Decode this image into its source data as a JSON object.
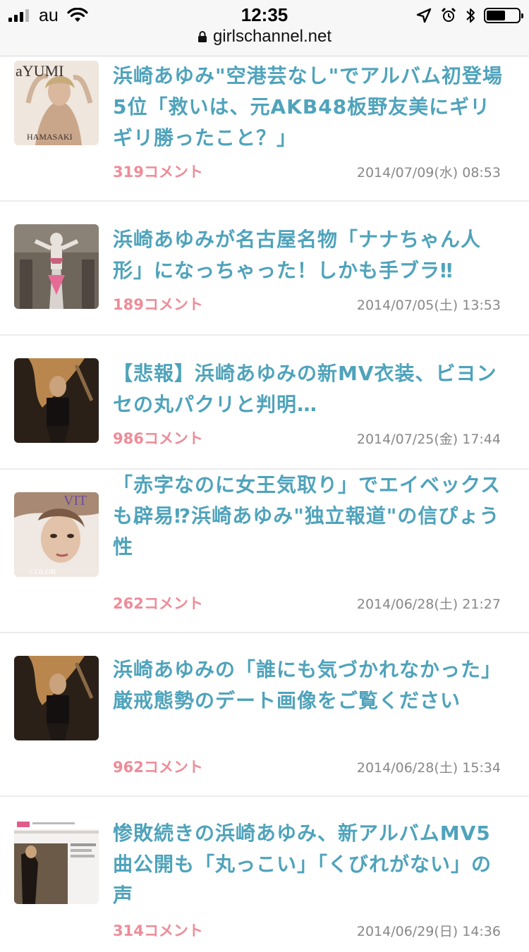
{
  "status_bar": {
    "carrier": "au",
    "time": "12:35",
    "url": "girlschannel.net",
    "battery_level": 0.6
  },
  "articles": [
    {
      "title": "浜崎あゆみ\"空港芸なし\"でアルバム初登場5位「救いは、元AKB48板野友美にギリギリ勝ったこと？」",
      "comments": "319コメント",
      "date": "2014/07/09(水) 08:53",
      "thumb_text": "aYUMI"
    },
    {
      "title": "浜崎あゆみが名古屋名物「ナナちゃん人形」になっちゃった！しかも手ブラ‼",
      "comments": "189コメント",
      "date": "2014/07/05(土) 13:53"
    },
    {
      "title": "【悲報】浜崎あゆみの新MV衣装、ビヨンセの丸パクリと判明…",
      "comments": "986コメント",
      "date": "2014/07/25(金) 17:44"
    },
    {
      "title": "「赤字なのに女王気取り」でエイベックスも辟易⁉浜崎あゆみ\"独立報道\"の信ぴょう性",
      "comments": "262コメント",
      "date": "2014/06/28(土) 21:27"
    },
    {
      "title": "浜崎あゆみの「誰にも気づかれなかった」厳戒態勢のデート画像をご覧ください",
      "comments": "962コメント",
      "date": "2014/06/28(土) 15:34"
    },
    {
      "title": "惨敗続きの浜崎あゆみ、新アルバムMV5曲公開も「丸っこい」「くびれがない」の声",
      "comments": "314コメント",
      "date": "2014/06/29(日) 14:36"
    }
  ]
}
